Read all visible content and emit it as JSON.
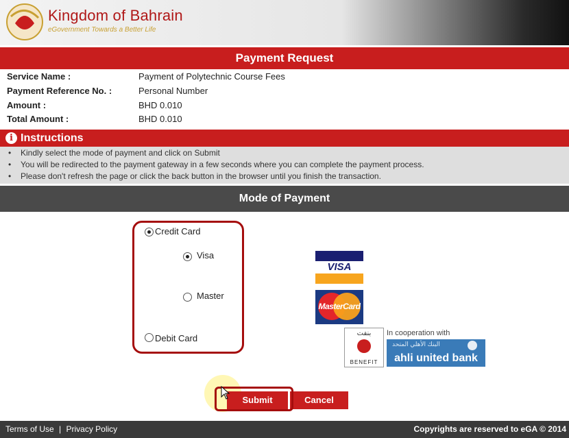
{
  "header": {
    "brand_name": "Kingdom of Bahrain",
    "tagline": "eGovernment Towards a Better Life"
  },
  "payment_request": {
    "title": "Payment Request",
    "fields": [
      {
        "label": "Service Name :",
        "value": "Payment of Polytechnic Course Fees"
      },
      {
        "label": "Payment Reference No. :",
        "value": "Personal Number"
      },
      {
        "label": "Amount :",
        "value": "BHD 0.010"
      },
      {
        "label": "Total Amount :",
        "value": "BHD 0.010"
      }
    ]
  },
  "instructions": {
    "title": "Instructions",
    "items": [
      "Kindly select the mode of payment and click on Submit",
      "You will be redirected to the payment gateway in a few seconds where you can complete the payment process.",
      "Please don't refresh the page or click the back button in the browser until you finish the transaction."
    ]
  },
  "mode_of_payment": {
    "title": "Mode of Payment",
    "options": {
      "credit_card": {
        "label": "Credit Card",
        "selected": true
      },
      "visa": {
        "label": "Visa",
        "selected": true
      },
      "master": {
        "label": "Master",
        "selected": false
      },
      "debit_card": {
        "label": "Debit Card",
        "selected": false
      }
    },
    "logos": {
      "visa": "VISA",
      "mastercard": "MasterCard",
      "benefit_arabic": "بنفت",
      "benefit": "BENEFIT",
      "cooperation_text": "In cooperation with",
      "bank_arabic": "البنك الأهلي المتحد",
      "bank": "ahli united bank"
    }
  },
  "actions": {
    "submit_label": "Submit",
    "cancel_label": "Cancel"
  },
  "footer": {
    "terms": "Terms of Use",
    "separator": "|",
    "privacy": "Privacy Policy",
    "copyright": "Copyrights are reserved to eGA © 2014"
  },
  "colors": {
    "brand_red": "#c81e1e",
    "highlight_red": "#a50d0d",
    "mode_bar_gray": "#4a4a4a",
    "footer_gray": "#3a3a3a"
  }
}
